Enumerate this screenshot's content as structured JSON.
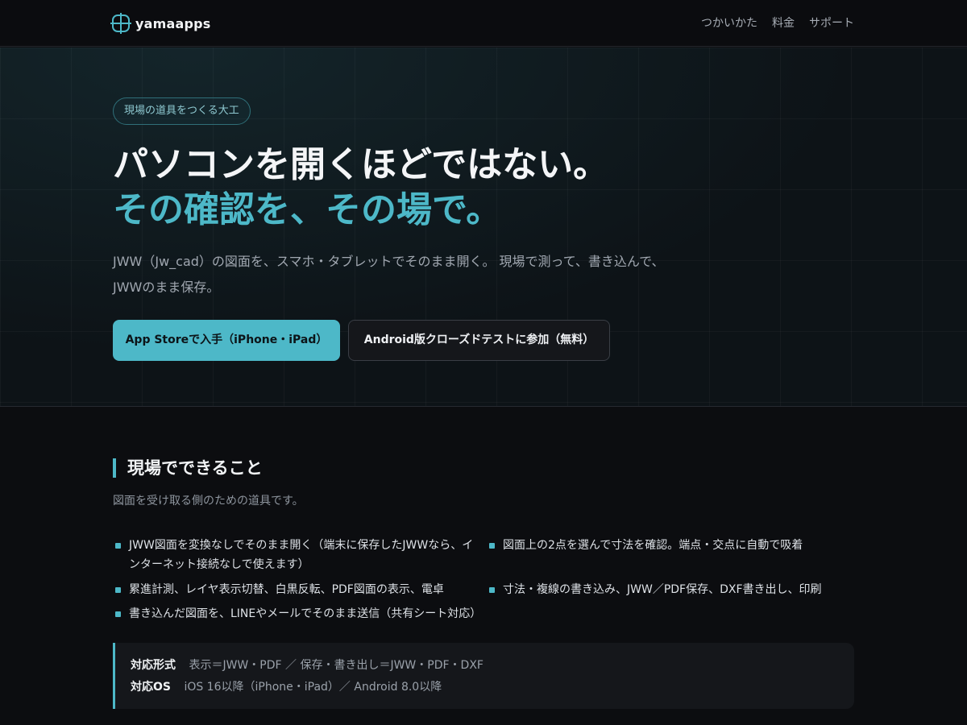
{
  "header": {
    "brand": "yamaapps",
    "nav": [
      {
        "label": "つかいかた"
      },
      {
        "label": "料金"
      },
      {
        "label": "サポート"
      }
    ]
  },
  "hero": {
    "pill": "現場の道具をつくる大工",
    "title_line1": "パソコンを開くほどではない。",
    "title_line2": "その確認を、その場で。",
    "lead": "JWW（Jw_cad）の図面を、スマホ・タブレットでそのまま開く。 現場で測って、書き込んで、JWWのまま保存。",
    "primary_button": "App Storeで入手（iPhone・iPad）",
    "secondary_button": "Android版クローズドテストに参加（無料）"
  },
  "features": {
    "title": "現場でできること",
    "subtitle": "図面を受け取る側のための道具です。",
    "items": [
      "JWW図面を変換なしでそのまま開く（端末に保存したJWWなら、インターネット接続なしで使えます）",
      "図面上の2点を選んで寸法を確認。端点・交点に自動で吸着",
      "累進計測、レイヤ表示切替、白黒反転、PDF図面の表示、電卓",
      "寸法・複線の書き込み、JWW／PDF保存、DXF書き出し、印刷",
      "書き込んだ図面を、LINEやメールでそのまま送信（共有シート対応）"
    ],
    "spec": {
      "formats_label": "対応形式",
      "formats_value": "表示＝JWW・PDF ／ 保存・書き出し＝JWW・PDF・DXF",
      "os_label": "対応OS",
      "os_value": "iOS 16以降（iPhone・iPad）／ Android 8.0以降"
    }
  },
  "colors": {
    "accent": "#4db8c8",
    "background": "#0c0d10"
  }
}
